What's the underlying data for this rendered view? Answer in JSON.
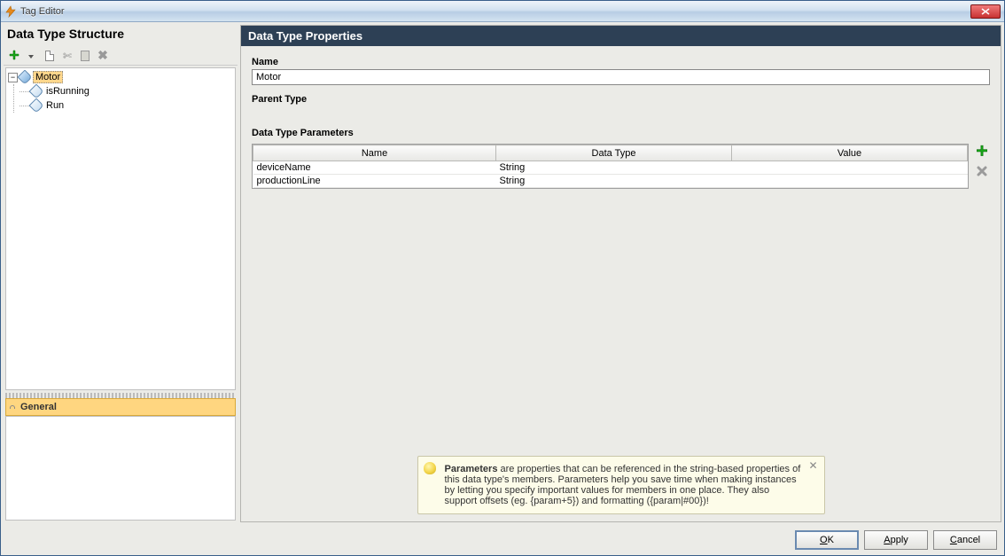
{
  "window": {
    "title": "Tag Editor"
  },
  "left": {
    "title": "Data Type Structure",
    "tree": {
      "root": {
        "label": "Motor"
      },
      "children": [
        {
          "label": "isRunning"
        },
        {
          "label": "Run"
        }
      ]
    },
    "general_tab": "General"
  },
  "props": {
    "header": "Data Type Properties",
    "name_label": "Name",
    "name_value": "Motor",
    "parent_label": "Parent Type",
    "params_label": "Data Type Parameters",
    "columns": {
      "name": "Name",
      "type": "Data Type",
      "value": "Value"
    },
    "rows": [
      {
        "name": "deviceName",
        "type": "String",
        "value": ""
      },
      {
        "name": "productionLine",
        "type": "String",
        "value": ""
      }
    ],
    "tip": {
      "bold": "Parameters",
      "text": " are properties that can be referenced in the string-based properties of this data type's members. Parameters help you save time when making instances by letting you specify important values for members in one place. They also support offsets (eg. {param+5}) and formatting ({param|#00})!"
    }
  },
  "footer": {
    "ok": "OK",
    "apply": "Apply",
    "cancel": "Cancel"
  }
}
